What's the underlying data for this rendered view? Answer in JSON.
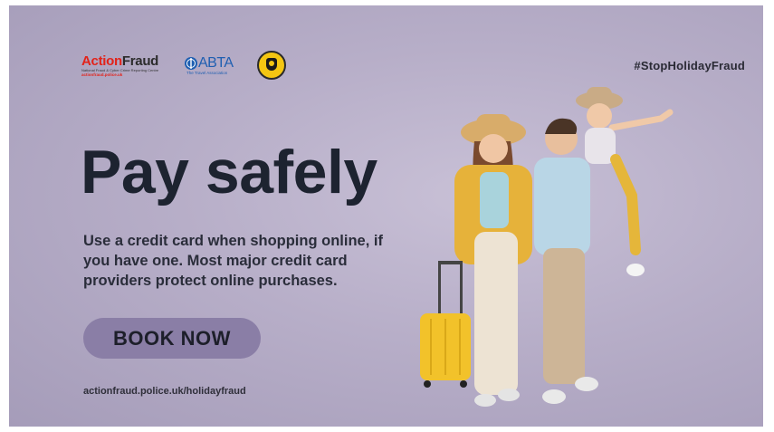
{
  "logos": {
    "actionfraud": {
      "name_part1": "Action",
      "name_part2": "Fraud",
      "subtitle": "National Fraud & Cyber Crime Reporting Centre",
      "url": "actionfraud.police.uk"
    },
    "abta": {
      "name": "ABTA",
      "subtitle": "The Travel Association"
    },
    "seal_icon": "uk-finance-seal"
  },
  "hashtag": "#StopHolidayFraud",
  "headline": "Pay safely",
  "body": "Use a credit card when shopping online, if you have one. Most major credit card providers protect online purchases.",
  "cta_label": "BOOK NOW",
  "footer_url": "actionfraud.police.uk/holidayfraud",
  "colors": {
    "background": "#b7aec8",
    "button": "#8a7ea6",
    "headline": "#1d2330",
    "brand_red": "#e2231a",
    "abta_blue": "#1f5fb1",
    "seal_yellow": "#f4c612"
  }
}
